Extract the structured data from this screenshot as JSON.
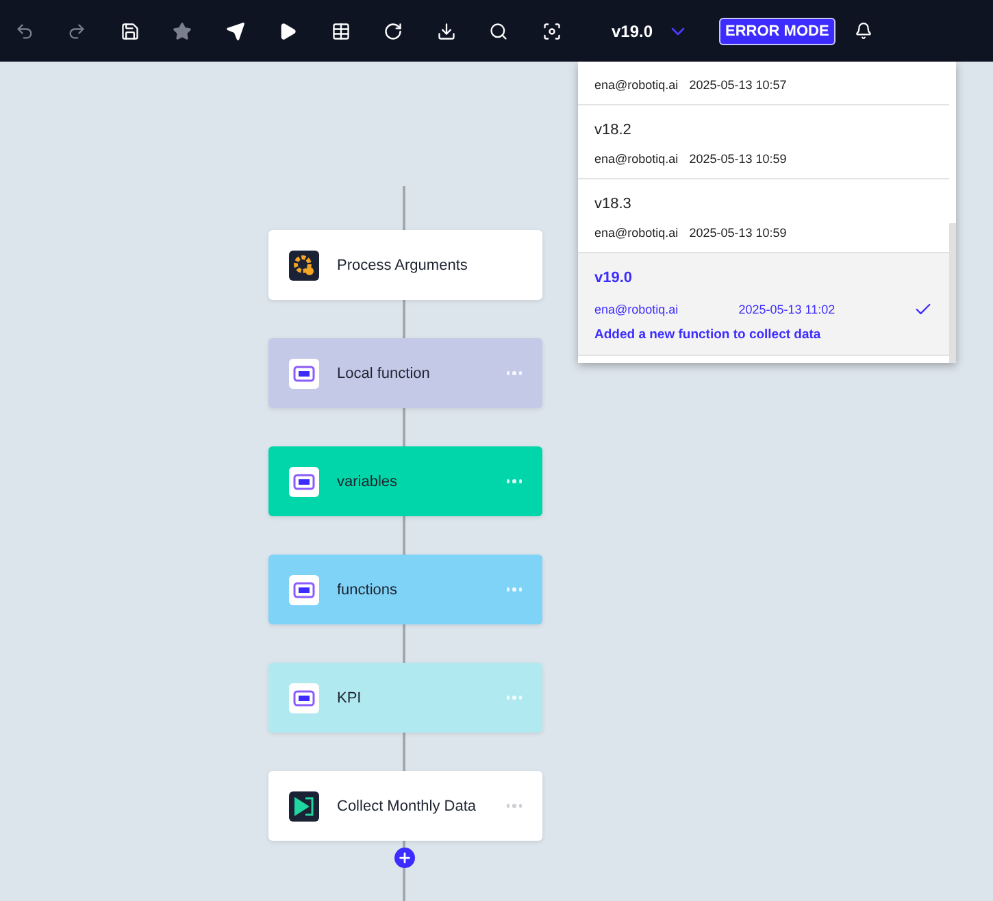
{
  "toolbar": {
    "buttons": [
      {
        "kind": "undo",
        "disabled": true
      },
      {
        "kind": "redo",
        "disabled": true
      },
      {
        "kind": "save",
        "disabled": false
      },
      {
        "kind": "star",
        "disabled": true
      },
      {
        "kind": "send",
        "disabled": false
      },
      {
        "kind": "play",
        "disabled": false
      },
      {
        "kind": "table",
        "disabled": false
      },
      {
        "kind": "refresh",
        "disabled": false
      },
      {
        "kind": "download",
        "disabled": false
      },
      {
        "kind": "search",
        "disabled": false
      },
      {
        "kind": "focus",
        "disabled": false
      }
    ],
    "version": "v19.0",
    "mode_button": "ERROR MODE"
  },
  "versions": [
    {
      "author": "ena@robotiq.ai",
      "date": "2025-05-13 10:57",
      "selected": false
    },
    {
      "title": "v18.2",
      "author": "ena@robotiq.ai",
      "date": "2025-05-13 10:59",
      "selected": false
    },
    {
      "title": "v18.3",
      "author": "ena@robotiq.ai",
      "date": "2025-05-13 10:59",
      "selected": false
    },
    {
      "title": "v19.0",
      "author": "ena@robotiq.ai",
      "date": "2025-05-13 11:02",
      "note": "Added a new function to collect data",
      "selected": true
    }
  ],
  "flow": [
    {
      "kind": "gear",
      "label": "Process Arguments",
      "color": "#ffffff",
      "menu": false
    },
    {
      "kind": "bracket",
      "label": "Local function",
      "color": "#c5c9e8",
      "menu": true
    },
    {
      "kind": "bracket",
      "label": "variables",
      "color": "#00d6a9",
      "menu": true
    },
    {
      "kind": "bracket",
      "label": "functions",
      "color": "#7fd3f7",
      "menu": true
    },
    {
      "kind": "bracket",
      "label": "KPI",
      "color": "#b0eaf0",
      "menu": true
    },
    {
      "kind": "play",
      "label": "Collect Monthly Data",
      "color": "#ffffff",
      "menu": true
    }
  ]
}
